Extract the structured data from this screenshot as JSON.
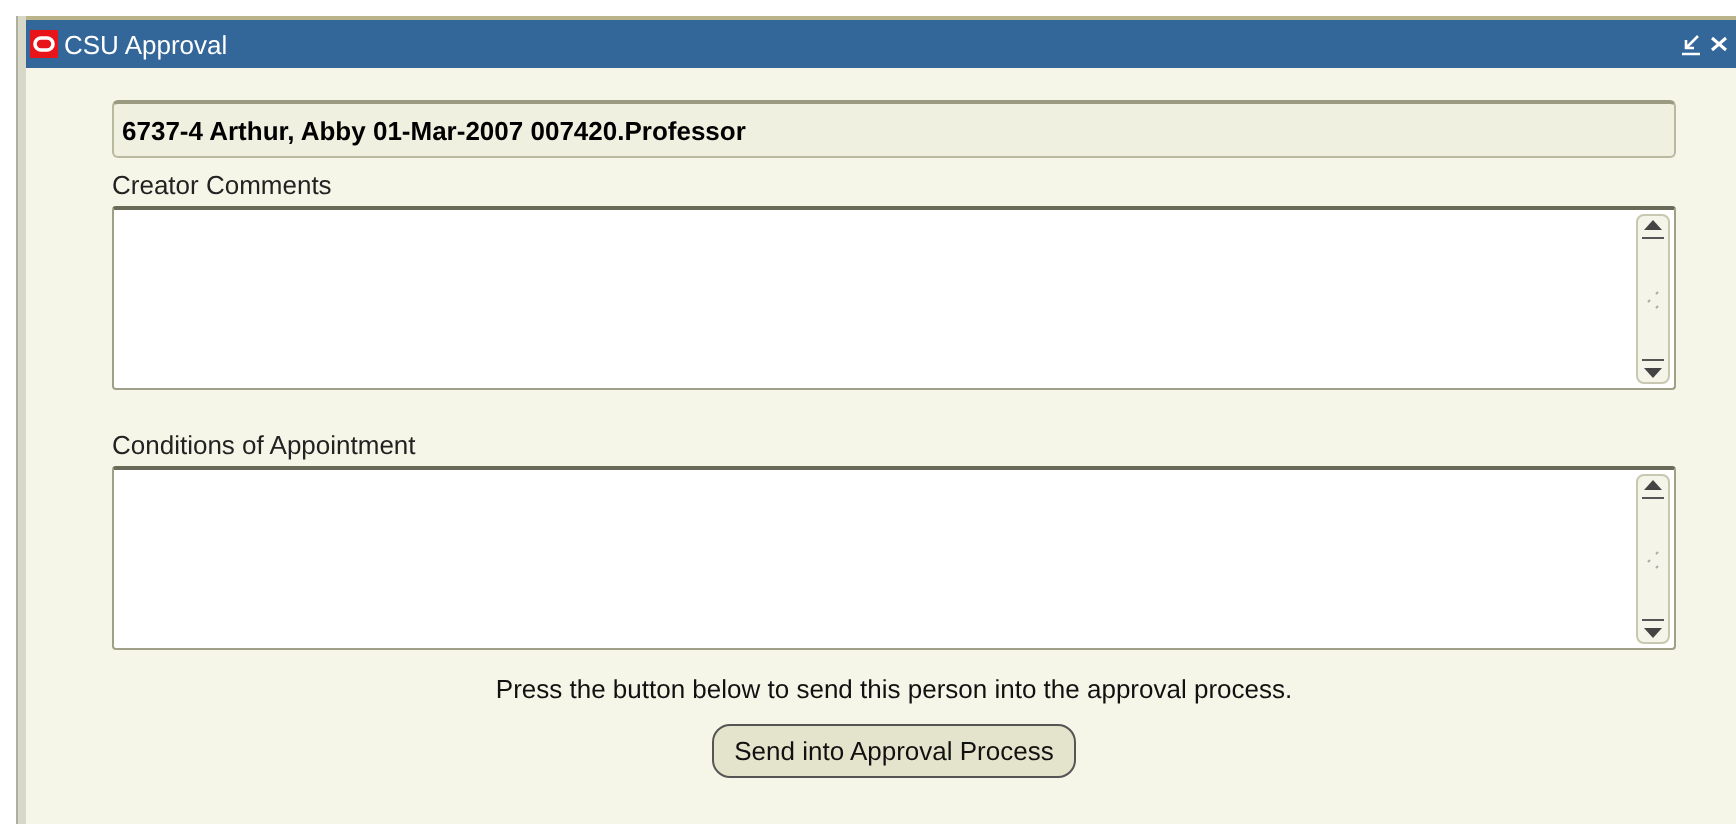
{
  "window": {
    "title": "CSU Approval"
  },
  "header_field": {
    "value": "6737-4 Arthur, Abby 01-Mar-2007 007420.Professor"
  },
  "fields": [
    {
      "label": "Creator Comments"
    },
    {
      "label": "Conditions of Appointment"
    }
  ],
  "instruction": "Press the button below to send this person into the approval process.",
  "button": {
    "label": "Send into Approval Process"
  }
}
